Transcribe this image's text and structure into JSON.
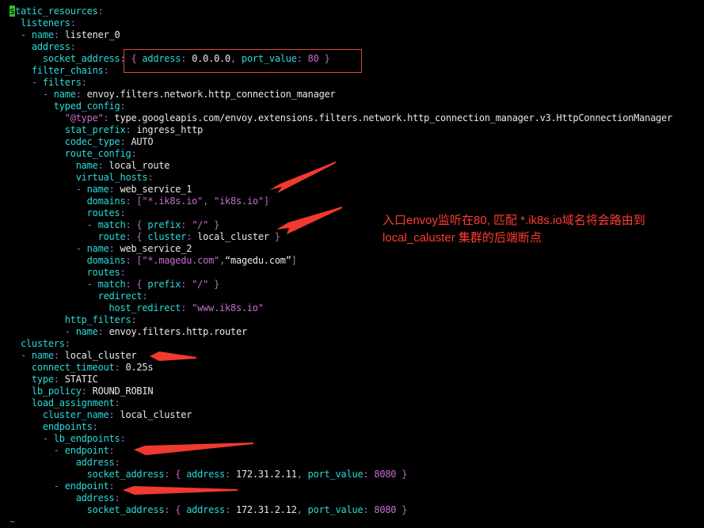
{
  "editor": {
    "lines": [
      [
        [
          "cursor",
          "s"
        ],
        [
          "k",
          "tatic_resources"
        ],
        [
          "p",
          ":"
        ]
      ],
      [
        [
          "k",
          "  listeners"
        ],
        [
          "p",
          ":"
        ]
      ],
      [
        [
          "p",
          "  - "
        ],
        [
          "k",
          "name"
        ],
        [
          "p",
          ": "
        ],
        [
          "v",
          "listener_0"
        ]
      ],
      [
        [
          "k",
          "    address"
        ],
        [
          "p",
          ":"
        ]
      ],
      [
        [
          "k",
          "      socket_address"
        ],
        [
          "p",
          ": { "
        ],
        [
          "k",
          "address"
        ],
        [
          "p",
          ": "
        ],
        [
          "v",
          "0.0.0.0"
        ],
        [
          "p",
          ", "
        ],
        [
          "k",
          "port_value"
        ],
        [
          "p",
          ": "
        ],
        [
          "n",
          "80"
        ],
        [
          "p",
          " }"
        ]
      ],
      [
        [
          "k",
          "    filter_chains"
        ],
        [
          "p",
          ":"
        ]
      ],
      [
        [
          "p",
          "    - "
        ],
        [
          "k",
          "filters"
        ],
        [
          "p",
          ":"
        ]
      ],
      [
        [
          "p",
          "      - "
        ],
        [
          "k",
          "name"
        ],
        [
          "p",
          ": "
        ],
        [
          "v",
          "envoy.filters.network.http_connection_manager"
        ]
      ],
      [
        [
          "k",
          "        typed_config"
        ],
        [
          "p",
          ":"
        ]
      ],
      [
        [
          "s",
          "          \"@type\""
        ],
        [
          "p",
          ": "
        ],
        [
          "v",
          "type.googleapis.com/envoy.extensions.filters.network.http_connection_manager.v3.HttpConnectionManager"
        ]
      ],
      [
        [
          "k",
          "          stat_prefix"
        ],
        [
          "p",
          ": "
        ],
        [
          "v",
          "ingress_http"
        ]
      ],
      [
        [
          "k",
          "          codec_type"
        ],
        [
          "p",
          ": "
        ],
        [
          "v",
          "AUTO"
        ]
      ],
      [
        [
          "k",
          "          route_config"
        ],
        [
          "p",
          ":"
        ]
      ],
      [
        [
          "k",
          "            name"
        ],
        [
          "p",
          ": "
        ],
        [
          "v",
          "local_route"
        ]
      ],
      [
        [
          "k",
          "            virtual_hosts"
        ],
        [
          "p",
          ":"
        ]
      ],
      [
        [
          "p",
          "            - "
        ],
        [
          "k",
          "name"
        ],
        [
          "p",
          ": "
        ],
        [
          "v",
          "web_service_1"
        ]
      ],
      [
        [
          "k",
          "              domains"
        ],
        [
          "p",
          ": ["
        ],
        [
          "s",
          "\"*.ik8s.io\""
        ],
        [
          "p",
          ", "
        ],
        [
          "s",
          "\"ik8s.io\""
        ],
        [
          "p",
          "]"
        ]
      ],
      [
        [
          "k",
          "              routes"
        ],
        [
          "p",
          ":"
        ]
      ],
      [
        [
          "p",
          "              - "
        ],
        [
          "k",
          "match"
        ],
        [
          "p",
          ": { "
        ],
        [
          "k",
          "prefix"
        ],
        [
          "p",
          ": "
        ],
        [
          "s",
          "\"/\""
        ],
        [
          "p",
          " }"
        ]
      ],
      [
        [
          "k",
          "                route"
        ],
        [
          "p",
          ": { "
        ],
        [
          "k",
          "cluster"
        ],
        [
          "p",
          ": "
        ],
        [
          "v",
          "local_cluster"
        ],
        [
          "p",
          " }"
        ]
      ],
      [
        [
          "p",
          "            - "
        ],
        [
          "k",
          "name"
        ],
        [
          "p",
          ": "
        ],
        [
          "v",
          "web_service_2"
        ]
      ],
      [
        [
          "k",
          "              domains"
        ],
        [
          "p",
          ": ["
        ],
        [
          "s",
          "\"*.magedu.com\""
        ],
        [
          "p",
          ","
        ],
        [
          "v",
          "“magedu.com”"
        ],
        [
          "p",
          "]"
        ]
      ],
      [
        [
          "k",
          "              routes"
        ],
        [
          "p",
          ":"
        ]
      ],
      [
        [
          "p",
          "              - "
        ],
        [
          "k",
          "match"
        ],
        [
          "p",
          ": { "
        ],
        [
          "k",
          "prefix"
        ],
        [
          "p",
          ": "
        ],
        [
          "s",
          "\"/\""
        ],
        [
          "p",
          " }"
        ]
      ],
      [
        [
          "k",
          "                redirect"
        ],
        [
          "p",
          ":"
        ]
      ],
      [
        [
          "k",
          "                  host_redirect"
        ],
        [
          "p",
          ": "
        ],
        [
          "s",
          "\"www.ik8s.io\""
        ]
      ],
      [
        [
          "k",
          "          http_filters"
        ],
        [
          "p",
          ":"
        ]
      ],
      [
        [
          "p",
          "          - "
        ],
        [
          "k",
          "name"
        ],
        [
          "p",
          ": "
        ],
        [
          "v",
          "envoy.filters.http.router"
        ]
      ],
      [
        [
          "k",
          "  clusters"
        ],
        [
          "p",
          ":"
        ]
      ],
      [
        [
          "p",
          "  - "
        ],
        [
          "k",
          "name"
        ],
        [
          "p",
          ": "
        ],
        [
          "v",
          "local_cluster"
        ]
      ],
      [
        [
          "k",
          "    connect_timeout"
        ],
        [
          "p",
          ": "
        ],
        [
          "v",
          "0.25s"
        ]
      ],
      [
        [
          "k",
          "    type"
        ],
        [
          "p",
          ": "
        ],
        [
          "v",
          "STATIC"
        ]
      ],
      [
        [
          "k",
          "    lb_policy"
        ],
        [
          "p",
          ": "
        ],
        [
          "v",
          "ROUND_ROBIN"
        ]
      ],
      [
        [
          "k",
          "    load_assignment"
        ],
        [
          "p",
          ":"
        ]
      ],
      [
        [
          "k",
          "      cluster_name"
        ],
        [
          "p",
          ": "
        ],
        [
          "v",
          "local_cluster"
        ]
      ],
      [
        [
          "k",
          "      endpoints"
        ],
        [
          "p",
          ":"
        ]
      ],
      [
        [
          "p",
          "      - "
        ],
        [
          "k",
          "lb_endpoints"
        ],
        [
          "p",
          ":"
        ]
      ],
      [
        [
          "p",
          "        - "
        ],
        [
          "k",
          "endpoint"
        ],
        [
          "p",
          ":"
        ]
      ],
      [
        [
          "k",
          "            address"
        ],
        [
          "p",
          ":"
        ]
      ],
      [
        [
          "k",
          "              socket_address"
        ],
        [
          "p",
          ": { "
        ],
        [
          "k",
          "address"
        ],
        [
          "p",
          ": "
        ],
        [
          "v",
          "172.31.2.11"
        ],
        [
          "p",
          ", "
        ],
        [
          "k",
          "port_value"
        ],
        [
          "p",
          ": "
        ],
        [
          "n",
          "8080"
        ],
        [
          "p",
          " }"
        ]
      ],
      [
        [
          "p",
          "        - "
        ],
        [
          "k",
          "endpoint"
        ],
        [
          "p",
          ":"
        ]
      ],
      [
        [
          "k",
          "            address"
        ],
        [
          "p",
          ":"
        ]
      ],
      [
        [
          "k",
          "              socket_address"
        ],
        [
          "p",
          ": { "
        ],
        [
          "k",
          "address"
        ],
        [
          "p",
          ": "
        ],
        [
          "v",
          "172.31.2.12"
        ],
        [
          "p",
          ", "
        ],
        [
          "k",
          "port_value"
        ],
        [
          "p",
          ": "
        ],
        [
          "n",
          "8080"
        ],
        [
          "p",
          " }"
        ]
      ],
      [
        [
          "tilde",
          "~"
        ]
      ]
    ]
  },
  "annotation": {
    "line1": "入口envoy监听在80, 匹配 *.ik8s.io域名将会路由到",
    "line2": "local_caluster 集群的后端断点"
  },
  "colors": {
    "background": "#000000",
    "key": "#2bd9d9",
    "string": "#c56ed0",
    "annotation": "#ff3b30",
    "cursor": "#2fc32f"
  }
}
